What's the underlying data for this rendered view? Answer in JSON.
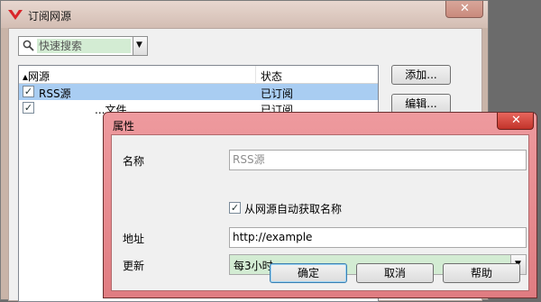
{
  "main_window": {
    "title": "订阅网源",
    "search": {
      "placeholder": "快速搜索"
    },
    "table": {
      "columns": [
        "网源",
        "状态"
      ],
      "rows": [
        {
          "name": "RSS源",
          "status": "已订阅",
          "checked": true,
          "selected": true
        },
        {
          "name": "                    ",
          "status": "已订阅",
          "checked": true,
          "selected": false,
          "name_visible": "...文件"
        }
      ]
    },
    "buttons": {
      "add": "添加...",
      "edit": "编辑..."
    }
  },
  "dialog": {
    "title": "属性",
    "name_label": "名称",
    "name_placeholder": "RSS源",
    "auto_name_label": "从网源自动获取名称",
    "address_label": "地址",
    "address_value": "http://example",
    "update_label": "更新",
    "update_value": "每3小时",
    "ok": "确定",
    "cancel": "取消",
    "help": "帮助"
  },
  "colors": {
    "selection": "#a9cdf2",
    "search_highlight": "#d3ecd3",
    "dialog_frame": "#e07c81"
  }
}
